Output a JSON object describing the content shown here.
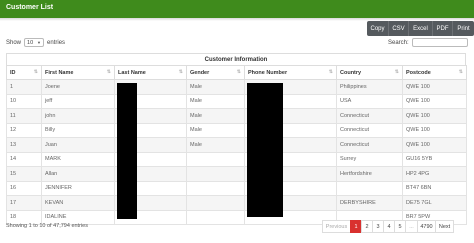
{
  "header": {
    "title": "Customer List"
  },
  "toolbar": {
    "buttons": [
      "Copy",
      "CSV",
      "Excel",
      "PDF",
      "Print"
    ]
  },
  "length": {
    "show_label": "Show",
    "value": "10",
    "entries_label": "entries"
  },
  "search": {
    "label": "Search:"
  },
  "table": {
    "caption": "Customer Information",
    "columns": [
      "ID",
      "First Name",
      "Last Name",
      "Gender",
      "Phone Number",
      "Country",
      "Postcode"
    ],
    "rows": [
      [
        "1",
        "Joene",
        "",
        "Male",
        "",
        "Philippines",
        "QWE 100"
      ],
      [
        "10",
        "jeff",
        "",
        "Male",
        "",
        "USA",
        "QWE 100"
      ],
      [
        "11",
        "john",
        "",
        "Male",
        "",
        "Connecticut",
        "QWE 100"
      ],
      [
        "12",
        "Billy",
        "",
        "Male",
        "",
        "Connecticut",
        "QWE 100"
      ],
      [
        "13",
        "Juan",
        "",
        "Male",
        "",
        "Connecticut",
        "QWE 100"
      ],
      [
        "14",
        "MARK",
        "",
        "",
        "",
        "Surrey",
        "GU16 5YB"
      ],
      [
        "15",
        "Allan",
        "",
        "",
        "",
        "Hertfordshire",
        "HP2 4PG"
      ],
      [
        "16",
        "JENNIFER",
        "",
        "",
        "",
        "",
        "BT47 6BN"
      ],
      [
        "17",
        "KEVAN",
        "",
        "",
        "",
        "DERBYSHIRE",
        "DE75 7GL"
      ],
      [
        "18",
        "IDALINE",
        "",
        "",
        "",
        "",
        "BR7 5PW"
      ]
    ]
  },
  "footer": {
    "info": "Showing 1 to 10 of 47,794 entries"
  },
  "pagination": {
    "previous": "Previous",
    "pages": [
      "1",
      "2",
      "3",
      "4",
      "5",
      "...",
      "4790"
    ],
    "next": "Next",
    "active": "1"
  },
  "colors": {
    "header_bar": "#3f8b1c",
    "toolbar_button": "#555a5e",
    "active_page": "#d9312f"
  }
}
